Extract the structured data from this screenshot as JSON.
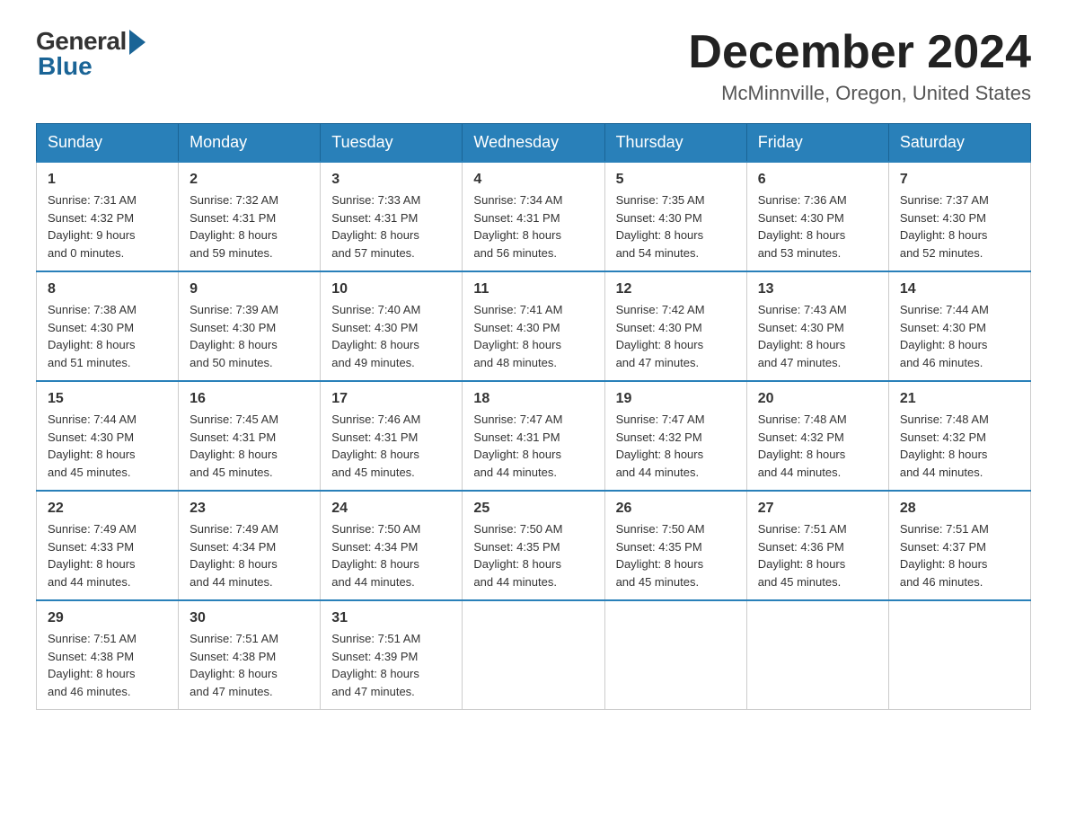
{
  "logo": {
    "general": "General",
    "blue": "Blue"
  },
  "title": "December 2024",
  "location": "McMinnville, Oregon, United States",
  "days_of_week": [
    "Sunday",
    "Monday",
    "Tuesday",
    "Wednesday",
    "Thursday",
    "Friday",
    "Saturday"
  ],
  "weeks": [
    [
      {
        "day": "1",
        "sunrise": "7:31 AM",
        "sunset": "4:32 PM",
        "daylight": "9 hours",
        "daylight2": "and 0 minutes."
      },
      {
        "day": "2",
        "sunrise": "7:32 AM",
        "sunset": "4:31 PM",
        "daylight": "8 hours",
        "daylight2": "and 59 minutes."
      },
      {
        "day": "3",
        "sunrise": "7:33 AM",
        "sunset": "4:31 PM",
        "daylight": "8 hours",
        "daylight2": "and 57 minutes."
      },
      {
        "day": "4",
        "sunrise": "7:34 AM",
        "sunset": "4:31 PM",
        "daylight": "8 hours",
        "daylight2": "and 56 minutes."
      },
      {
        "day": "5",
        "sunrise": "7:35 AM",
        "sunset": "4:30 PM",
        "daylight": "8 hours",
        "daylight2": "and 54 minutes."
      },
      {
        "day": "6",
        "sunrise": "7:36 AM",
        "sunset": "4:30 PM",
        "daylight": "8 hours",
        "daylight2": "and 53 minutes."
      },
      {
        "day": "7",
        "sunrise": "7:37 AM",
        "sunset": "4:30 PM",
        "daylight": "8 hours",
        "daylight2": "and 52 minutes."
      }
    ],
    [
      {
        "day": "8",
        "sunrise": "7:38 AM",
        "sunset": "4:30 PM",
        "daylight": "8 hours",
        "daylight2": "and 51 minutes."
      },
      {
        "day": "9",
        "sunrise": "7:39 AM",
        "sunset": "4:30 PM",
        "daylight": "8 hours",
        "daylight2": "and 50 minutes."
      },
      {
        "day": "10",
        "sunrise": "7:40 AM",
        "sunset": "4:30 PM",
        "daylight": "8 hours",
        "daylight2": "and 49 minutes."
      },
      {
        "day": "11",
        "sunrise": "7:41 AM",
        "sunset": "4:30 PM",
        "daylight": "8 hours",
        "daylight2": "and 48 minutes."
      },
      {
        "day": "12",
        "sunrise": "7:42 AM",
        "sunset": "4:30 PM",
        "daylight": "8 hours",
        "daylight2": "and 47 minutes."
      },
      {
        "day": "13",
        "sunrise": "7:43 AM",
        "sunset": "4:30 PM",
        "daylight": "8 hours",
        "daylight2": "and 47 minutes."
      },
      {
        "day": "14",
        "sunrise": "7:44 AM",
        "sunset": "4:30 PM",
        "daylight": "8 hours",
        "daylight2": "and 46 minutes."
      }
    ],
    [
      {
        "day": "15",
        "sunrise": "7:44 AM",
        "sunset": "4:30 PM",
        "daylight": "8 hours",
        "daylight2": "and 45 minutes."
      },
      {
        "day": "16",
        "sunrise": "7:45 AM",
        "sunset": "4:31 PM",
        "daylight": "8 hours",
        "daylight2": "and 45 minutes."
      },
      {
        "day": "17",
        "sunrise": "7:46 AM",
        "sunset": "4:31 PM",
        "daylight": "8 hours",
        "daylight2": "and 45 minutes."
      },
      {
        "day": "18",
        "sunrise": "7:47 AM",
        "sunset": "4:31 PM",
        "daylight": "8 hours",
        "daylight2": "and 44 minutes."
      },
      {
        "day": "19",
        "sunrise": "7:47 AM",
        "sunset": "4:32 PM",
        "daylight": "8 hours",
        "daylight2": "and 44 minutes."
      },
      {
        "day": "20",
        "sunrise": "7:48 AM",
        "sunset": "4:32 PM",
        "daylight": "8 hours",
        "daylight2": "and 44 minutes."
      },
      {
        "day": "21",
        "sunrise": "7:48 AM",
        "sunset": "4:32 PM",
        "daylight": "8 hours",
        "daylight2": "and 44 minutes."
      }
    ],
    [
      {
        "day": "22",
        "sunrise": "7:49 AM",
        "sunset": "4:33 PM",
        "daylight": "8 hours",
        "daylight2": "and 44 minutes."
      },
      {
        "day": "23",
        "sunrise": "7:49 AM",
        "sunset": "4:34 PM",
        "daylight": "8 hours",
        "daylight2": "and 44 minutes."
      },
      {
        "day": "24",
        "sunrise": "7:50 AM",
        "sunset": "4:34 PM",
        "daylight": "8 hours",
        "daylight2": "and 44 minutes."
      },
      {
        "day": "25",
        "sunrise": "7:50 AM",
        "sunset": "4:35 PM",
        "daylight": "8 hours",
        "daylight2": "and 44 minutes."
      },
      {
        "day": "26",
        "sunrise": "7:50 AM",
        "sunset": "4:35 PM",
        "daylight": "8 hours",
        "daylight2": "and 45 minutes."
      },
      {
        "day": "27",
        "sunrise": "7:51 AM",
        "sunset": "4:36 PM",
        "daylight": "8 hours",
        "daylight2": "and 45 minutes."
      },
      {
        "day": "28",
        "sunrise": "7:51 AM",
        "sunset": "4:37 PM",
        "daylight": "8 hours",
        "daylight2": "and 46 minutes."
      }
    ],
    [
      {
        "day": "29",
        "sunrise": "7:51 AM",
        "sunset": "4:38 PM",
        "daylight": "8 hours",
        "daylight2": "and 46 minutes."
      },
      {
        "day": "30",
        "sunrise": "7:51 AM",
        "sunset": "4:38 PM",
        "daylight": "8 hours",
        "daylight2": "and 47 minutes."
      },
      {
        "day": "31",
        "sunrise": "7:51 AM",
        "sunset": "4:39 PM",
        "daylight": "8 hours",
        "daylight2": "and 47 minutes."
      },
      null,
      null,
      null,
      null
    ]
  ]
}
